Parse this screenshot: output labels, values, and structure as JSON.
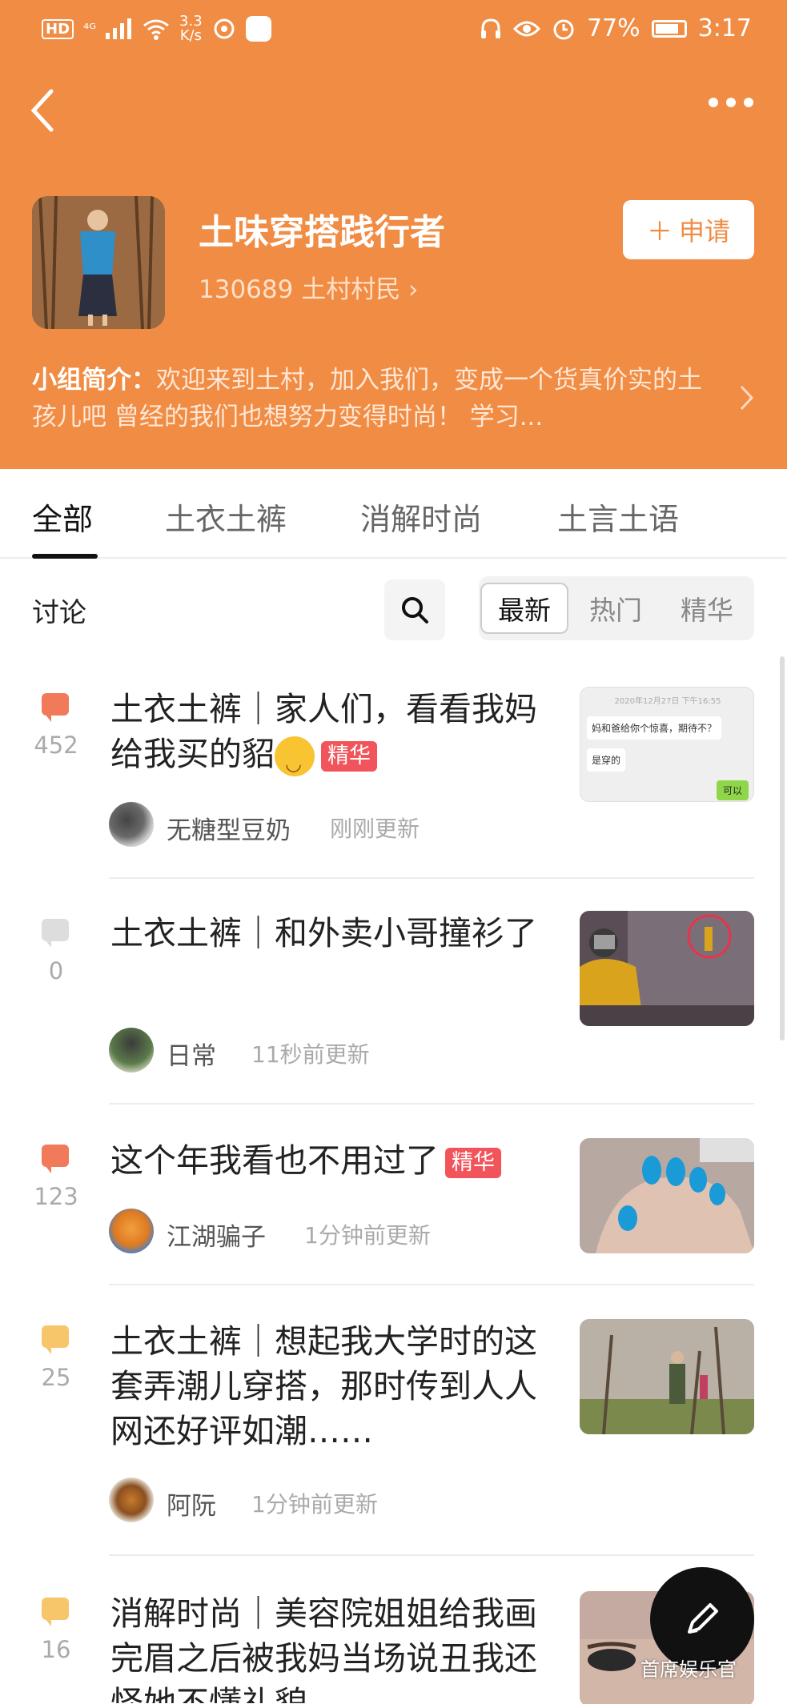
{
  "status_bar": {
    "network": "HD",
    "signal": "⁴ᴳ",
    "speed_value": "3.3",
    "speed_unit": "K/s",
    "battery": "77%",
    "time": "3:17"
  },
  "group": {
    "name": "土味穿搭践行者",
    "members": "130689 土村村民",
    "apply_label": "申请",
    "intro_label": "小组简介：",
    "intro_text": "欢迎来到土村，加入我们，变成一个货真价实的土孩儿吧  曾经的我们也想努力变得时尚！ 学习..."
  },
  "tabs": [
    {
      "label": "全部"
    },
    {
      "label": "土衣土裤"
    },
    {
      "label": "消解时尚"
    },
    {
      "label": "土言土语"
    }
  ],
  "filter": {
    "section_label": "讨论",
    "sort": [
      "最新",
      "热门",
      "精华"
    ]
  },
  "posts": [
    {
      "comments": "452",
      "title": "土衣土裤｜家人们，看看我妈给我买的貂",
      "tag": "精华",
      "user": "无糖型豆奶",
      "time": "刚刚更新",
      "thumb_date": "2020年12月27日 下午16:55",
      "thumb_msg1": "妈和爸给你个惊喜，期待不？",
      "thumb_msg2": "是穿的",
      "thumb_msg3": "可以"
    },
    {
      "comments": "0",
      "title": "土衣土裤｜和外卖小哥撞衫了",
      "user": "日常",
      "time": "11秒前更新"
    },
    {
      "comments": "123",
      "title": "这个年我看也不用过了",
      "tag": "精华",
      "user": "江湖骗子",
      "time": "1分钟前更新"
    },
    {
      "comments": "25",
      "title": "土衣土裤｜想起我大学时的这套弄潮儿穿搭，那时传到人人网还好评如潮……",
      "user": "阿阮",
      "time": "1分钟前更新"
    },
    {
      "comments": "16",
      "title": "消解时尚｜美容院姐姐给我画完眉之后被我妈当场说丑我还怪她不懂礼貌"
    }
  ],
  "watermark": "首席娱乐官",
  "colors": {
    "brand": "#f08c44",
    "tag": "#f2545b",
    "comment_hot": "#f07a5a",
    "comment_warm": "#f7c56a",
    "comment_none": "#dddddd"
  }
}
